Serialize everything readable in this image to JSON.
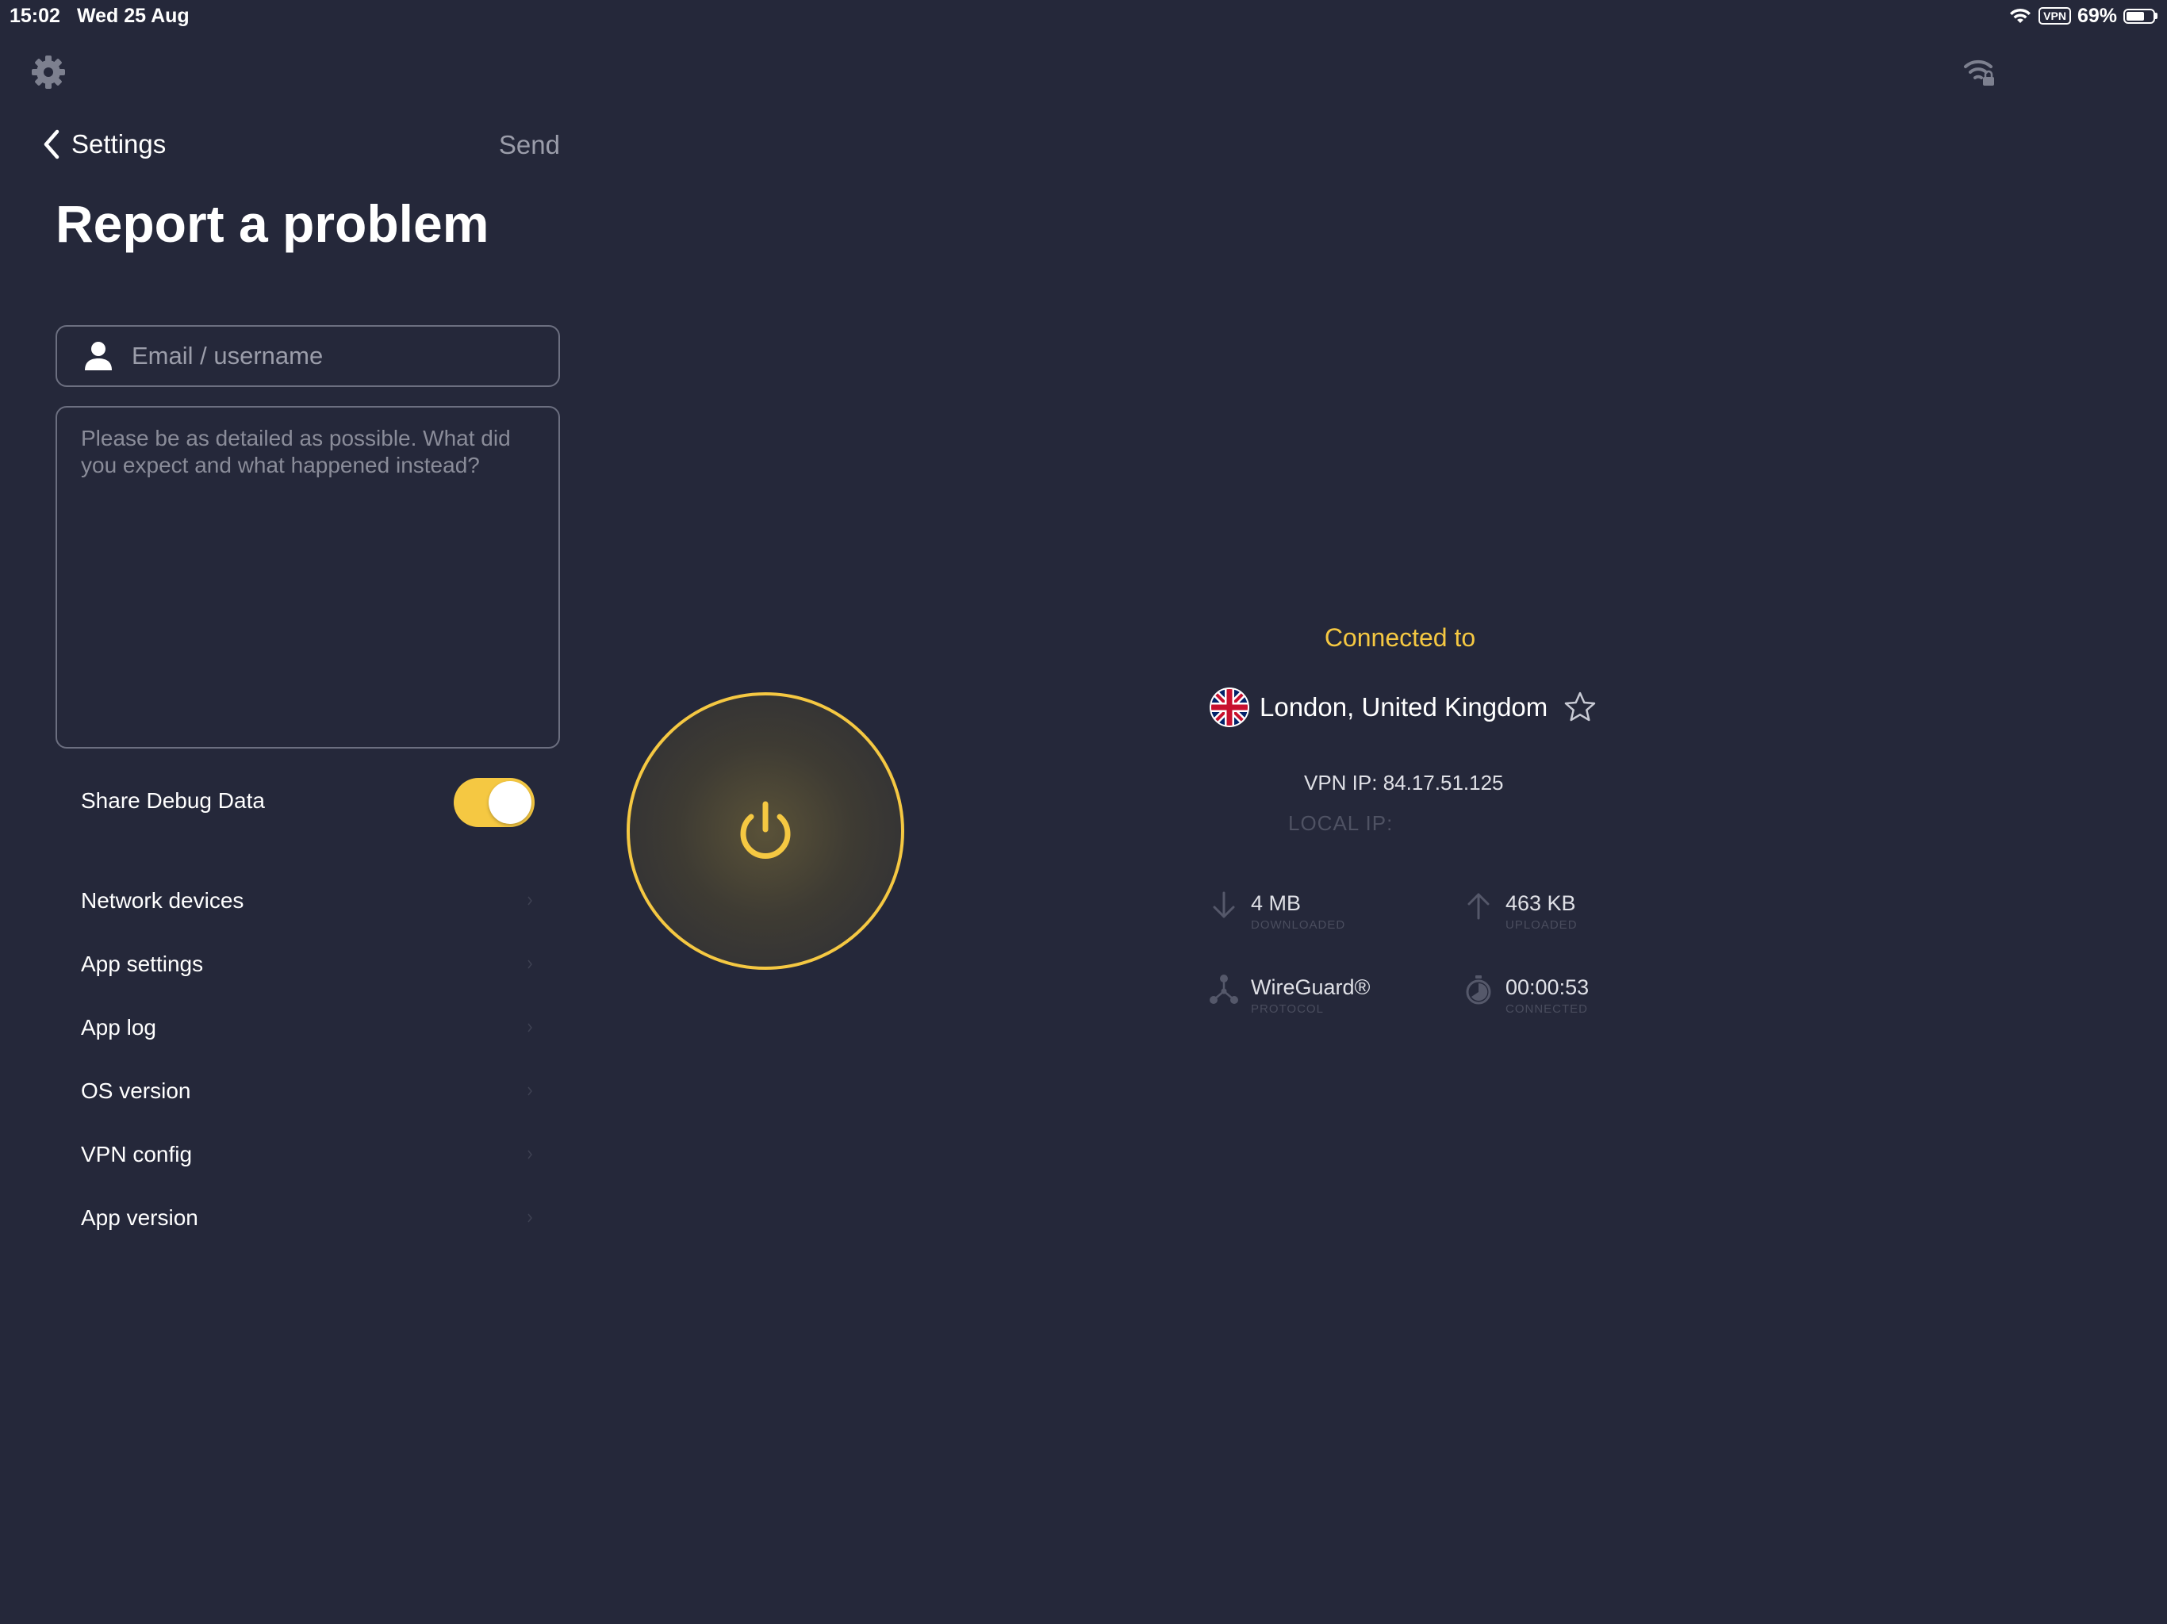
{
  "status_bar": {
    "time": "15:02",
    "date": "Wed 25 Aug",
    "vpn_badge": "VPN",
    "battery_percent": "69%",
    "battery_level": 0.69
  },
  "colors": {
    "background": "#25283a",
    "accent": "#f5c842",
    "muted_text": "#9b9daa",
    "border": "#6c6f80"
  },
  "icons": {
    "settings": "gear-icon",
    "network": "wifi-lock-icon",
    "back": "chevron-left-icon",
    "user": "user-icon",
    "power": "power-icon",
    "favorite": "star-outline-icon",
    "download": "arrow-down-icon",
    "upload": "arrow-up-icon",
    "protocol": "protocol-icon",
    "timer": "timer-icon",
    "flag": "uk-flag-icon"
  },
  "report": {
    "back_label": "Settings",
    "send_label": "Send",
    "title": "Report a problem",
    "email_placeholder": "Email / username",
    "email_value": "",
    "details_placeholder": "Please be as detailed as possible. What did you expect and what happened instead?",
    "details_value": "",
    "debug_label": "Share Debug Data",
    "debug_enabled": true,
    "info_items": [
      {
        "label": "Network devices"
      },
      {
        "label": "App settings"
      },
      {
        "label": "App log"
      },
      {
        "label": "OS version"
      },
      {
        "label": "VPN config"
      },
      {
        "label": "App version"
      }
    ]
  },
  "connection": {
    "status_label": "Connected to",
    "location": "London, United Kingdom",
    "vpn_ip": "VPN IP: 84.17.51.125",
    "local_ip": "LOCAL IP:",
    "downloaded": {
      "value": "4 MB",
      "label": "DOWNLOADED"
    },
    "uploaded": {
      "value": "463 KB",
      "label": "UPLOADED"
    },
    "protocol": {
      "value": "WireGuard®",
      "label": "PROTOCOL"
    },
    "connected_time": {
      "value": "00:00:53",
      "label": "CONNECTED"
    }
  }
}
